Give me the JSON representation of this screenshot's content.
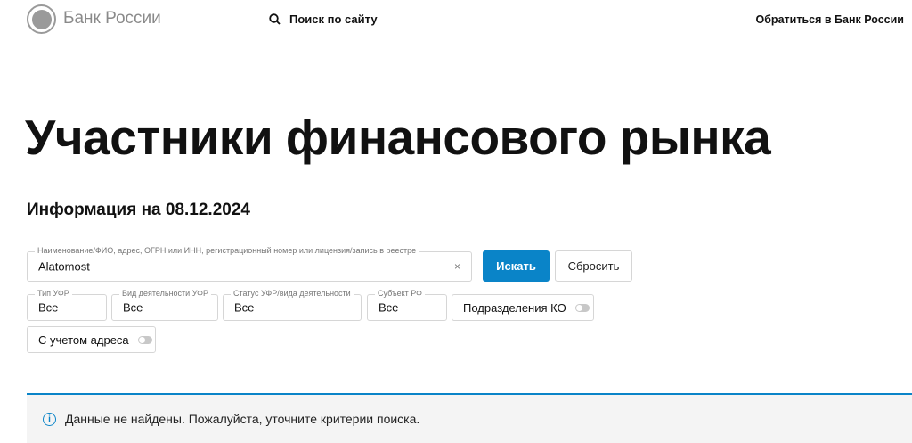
{
  "header": {
    "brand": "Банк России",
    "search_label": "Поиск по сайту",
    "contact_link": "Обратиться в Банк России"
  },
  "page": {
    "title": "Участники финансового рынка",
    "subtitle": "Информация на 08.12.2024"
  },
  "search": {
    "label": "Наименование/ФИО, адрес, ОГРН или ИНН, регистрационный номер или лицензия/запись в реестре",
    "value": "Alatomost",
    "clear": "×",
    "submit": "Искать",
    "reset": "Сбросить"
  },
  "filters": [
    {
      "label": "Тип УФР",
      "value": "Все"
    },
    {
      "label": "Вид деятельности УФР",
      "value": "Все"
    },
    {
      "label": "Статус УФР/вида деятельности",
      "value": "Все"
    },
    {
      "label": "Субъект РФ",
      "value": "Все"
    }
  ],
  "toggles": {
    "branches": "Подразделения КО",
    "address": "С учетом адреса"
  },
  "alert": {
    "icon": "i",
    "message": "Данные не найдены. Пожалуйста, уточните критерии поиска."
  }
}
